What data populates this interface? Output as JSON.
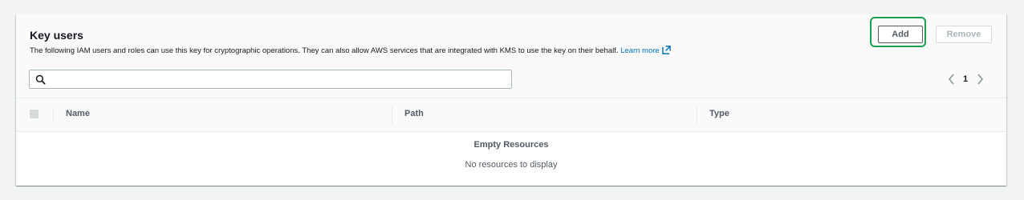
{
  "panel": {
    "title": "Key users",
    "description": "The following IAM users and roles can use this key for cryptographic operations. They can also allow AWS services that are integrated with KMS to use the key on their behalf.",
    "learn_more": "Learn more",
    "learn_more_icon": "external-link-icon"
  },
  "actions": {
    "add_label": "Add",
    "remove_label": "Remove",
    "highlight_color": "#1aa050"
  },
  "search": {
    "value": "",
    "placeholder": "",
    "icon": "search-icon"
  },
  "pagination": {
    "current_page": "1",
    "prev_icon": "chevron-left-icon",
    "next_icon": "chevron-right-icon"
  },
  "table": {
    "columns": [
      "Name",
      "Path",
      "Type"
    ],
    "rows": []
  },
  "empty_state": {
    "title": "Empty Resources",
    "message": "No resources to display"
  }
}
